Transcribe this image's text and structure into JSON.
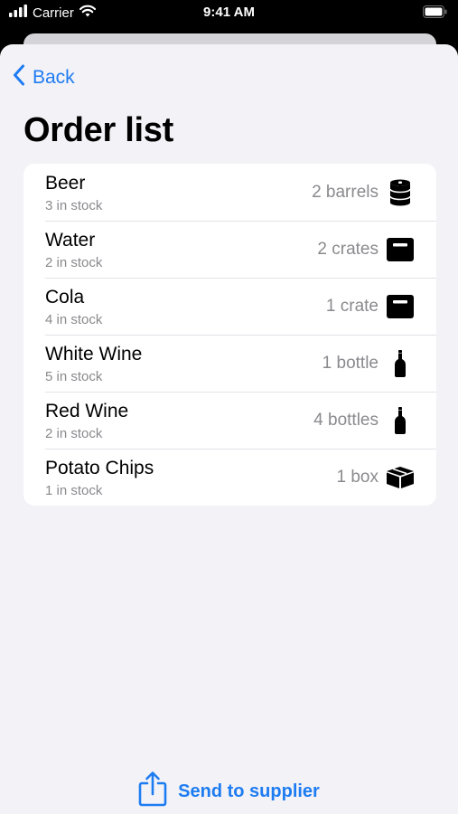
{
  "status_bar": {
    "carrier": "Carrier",
    "time": "9:41 AM"
  },
  "nav": {
    "back_label": "Back"
  },
  "title": "Order list",
  "items": [
    {
      "name": "Beer",
      "stock": "3 in stock",
      "quantity": "2 barrels",
      "icon": "barrel-icon"
    },
    {
      "name": "Water",
      "stock": "2 in stock",
      "quantity": "2 crates",
      "icon": "crate-icon"
    },
    {
      "name": "Cola",
      "stock": "4 in stock",
      "quantity": "1 crate",
      "icon": "crate-icon"
    },
    {
      "name": "White Wine",
      "stock": "5 in stock",
      "quantity": "1 bottle",
      "icon": "bottle-icon"
    },
    {
      "name": "Red Wine",
      "stock": "2 in stock",
      "quantity": "4 bottles",
      "icon": "bottle-icon"
    },
    {
      "name": "Potato Chips",
      "stock": "1 in stock",
      "quantity": "1 box",
      "icon": "box-icon"
    }
  ],
  "footer": {
    "action_label": "Send to supplier",
    "action_icon": "share-icon"
  },
  "colors": {
    "accent": "#1e7cf2",
    "background": "#f2f2f7",
    "secondary_text": "#8a8a8e"
  }
}
